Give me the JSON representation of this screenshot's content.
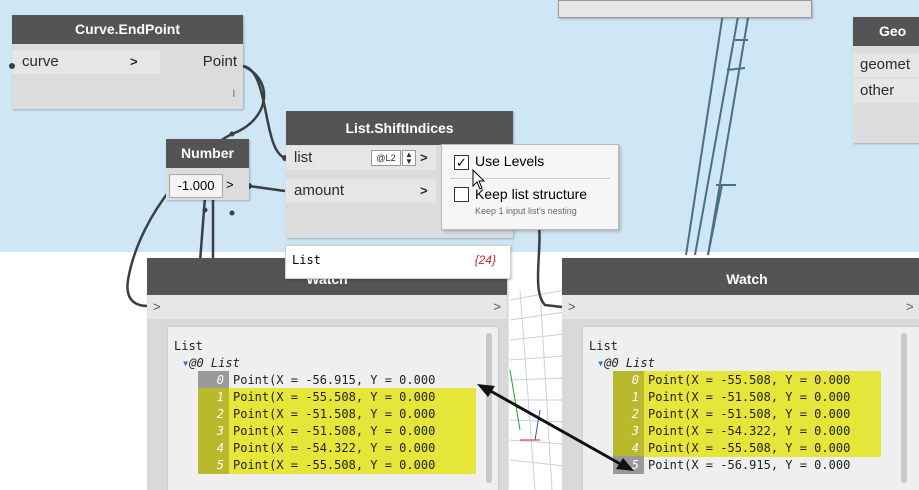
{
  "colors": {
    "canvas_top": "#cfe6f5",
    "canvas_bottom": "#ffffff",
    "node_title": "#545454",
    "node_body": "#dcdcdc",
    "highlight": "#e6e63a",
    "wire": "#3a3f44"
  },
  "curve_endpoint": {
    "title": "Curve.EndPoint",
    "input_label": "curve",
    "output_label": "Point",
    "lacing": "l"
  },
  "number_node": {
    "title": "Number",
    "value": "-1.000",
    "output_arrow": ">"
  },
  "shift_indices": {
    "title": "List.ShiftIndices",
    "inputs": [
      {
        "label": "list",
        "level": "@L2"
      },
      {
        "label": "amount"
      }
    ]
  },
  "geometry_node": {
    "title": "Geo",
    "inputs": [
      "geomet",
      "other"
    ]
  },
  "level_popup": {
    "use_levels_label": "Use Levels",
    "use_levels_checked": true,
    "keep_structure_label": "Keep list structure",
    "keep_structure_checked": false,
    "keep_structure_hint": "Keep 1 input list's nesting"
  },
  "preview_bubble": {
    "label": "List",
    "count": "{24}"
  },
  "watch_left": {
    "title": "Watch",
    "port_in": ">",
    "port_out": ">",
    "root": "List",
    "sublist": "@0 List",
    "items": [
      {
        "index": "0",
        "text": "Point(X = -56.915, Y = 0.000"
      },
      {
        "index": "1",
        "text": "Point(X = -55.508, Y = 0.000"
      },
      {
        "index": "2",
        "text": "Point(X = -51.508, Y = 0.000"
      },
      {
        "index": "3",
        "text": "Point(X = -51.508, Y = 0.000"
      },
      {
        "index": "4",
        "text": "Point(X = -54.322, Y = 0.000"
      },
      {
        "index": "5",
        "text": "Point(X = -55.508, Y = 0.000"
      }
    ]
  },
  "watch_right": {
    "title": "Watch",
    "port_in": ">",
    "port_out": ">",
    "root": "List",
    "sublist": "@0 List",
    "items": [
      {
        "index": "0",
        "text": "Point(X = -55.508, Y = 0.000"
      },
      {
        "index": "1",
        "text": "Point(X = -51.508, Y = 0.000"
      },
      {
        "index": "2",
        "text": "Point(X = -51.508, Y = 0.000"
      },
      {
        "index": "3",
        "text": "Point(X = -54.322, Y = 0.000"
      },
      {
        "index": "4",
        "text": "Point(X = -55.508, Y = 0.000"
      },
      {
        "index": "5",
        "text": "Point(X = -56.915, Y = 0.000"
      }
    ]
  }
}
